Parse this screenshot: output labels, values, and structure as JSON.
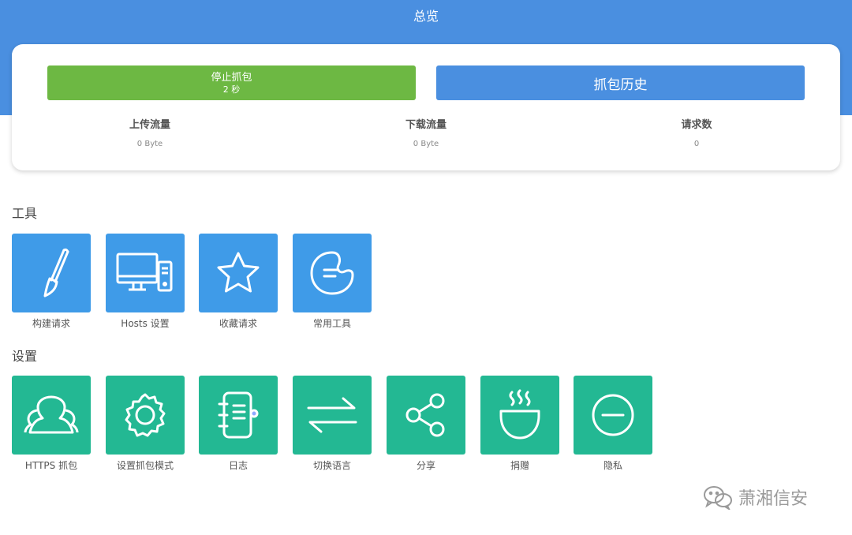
{
  "header": {
    "title": "总览"
  },
  "capture": {
    "stop_label": "停止抓包",
    "elapsed": "2 秒",
    "history_label": "抓包历史"
  },
  "stats": [
    {
      "label": "上传流量",
      "value": "0 Byte"
    },
    {
      "label": "下载流量",
      "value": "0 Byte"
    },
    {
      "label": "请求数",
      "value": "0"
    }
  ],
  "tools": {
    "title": "工具",
    "items": [
      {
        "label": "构建请求",
        "icon": "brush-icon"
      },
      {
        "label": "Hosts 设置",
        "icon": "computer-icon"
      },
      {
        "label": "收藏请求",
        "icon": "star-icon"
      },
      {
        "label": "常用工具",
        "icon": "palette-icon"
      }
    ]
  },
  "settings": {
    "title": "设置",
    "items": [
      {
        "label": "HTTPS 抓包",
        "icon": "users-icon"
      },
      {
        "label": "设置抓包模式",
        "icon": "gear-icon"
      },
      {
        "label": "日志",
        "icon": "notebook-icon"
      },
      {
        "label": "切换语言",
        "icon": "swap-icon"
      },
      {
        "label": "分享",
        "icon": "share-icon"
      },
      {
        "label": "捐赠",
        "icon": "coffee-icon"
      },
      {
        "label": "隐私",
        "icon": "minus-circle-icon"
      }
    ]
  },
  "watermark": {
    "text": "萧湘信安",
    "icon": "wechat-icon"
  },
  "colors": {
    "header": "#4a8fe0",
    "stop_button": "#6db843",
    "history_button": "#4a8fe0",
    "tool_tile": "#3f9be8",
    "setting_tile": "#23b893"
  }
}
